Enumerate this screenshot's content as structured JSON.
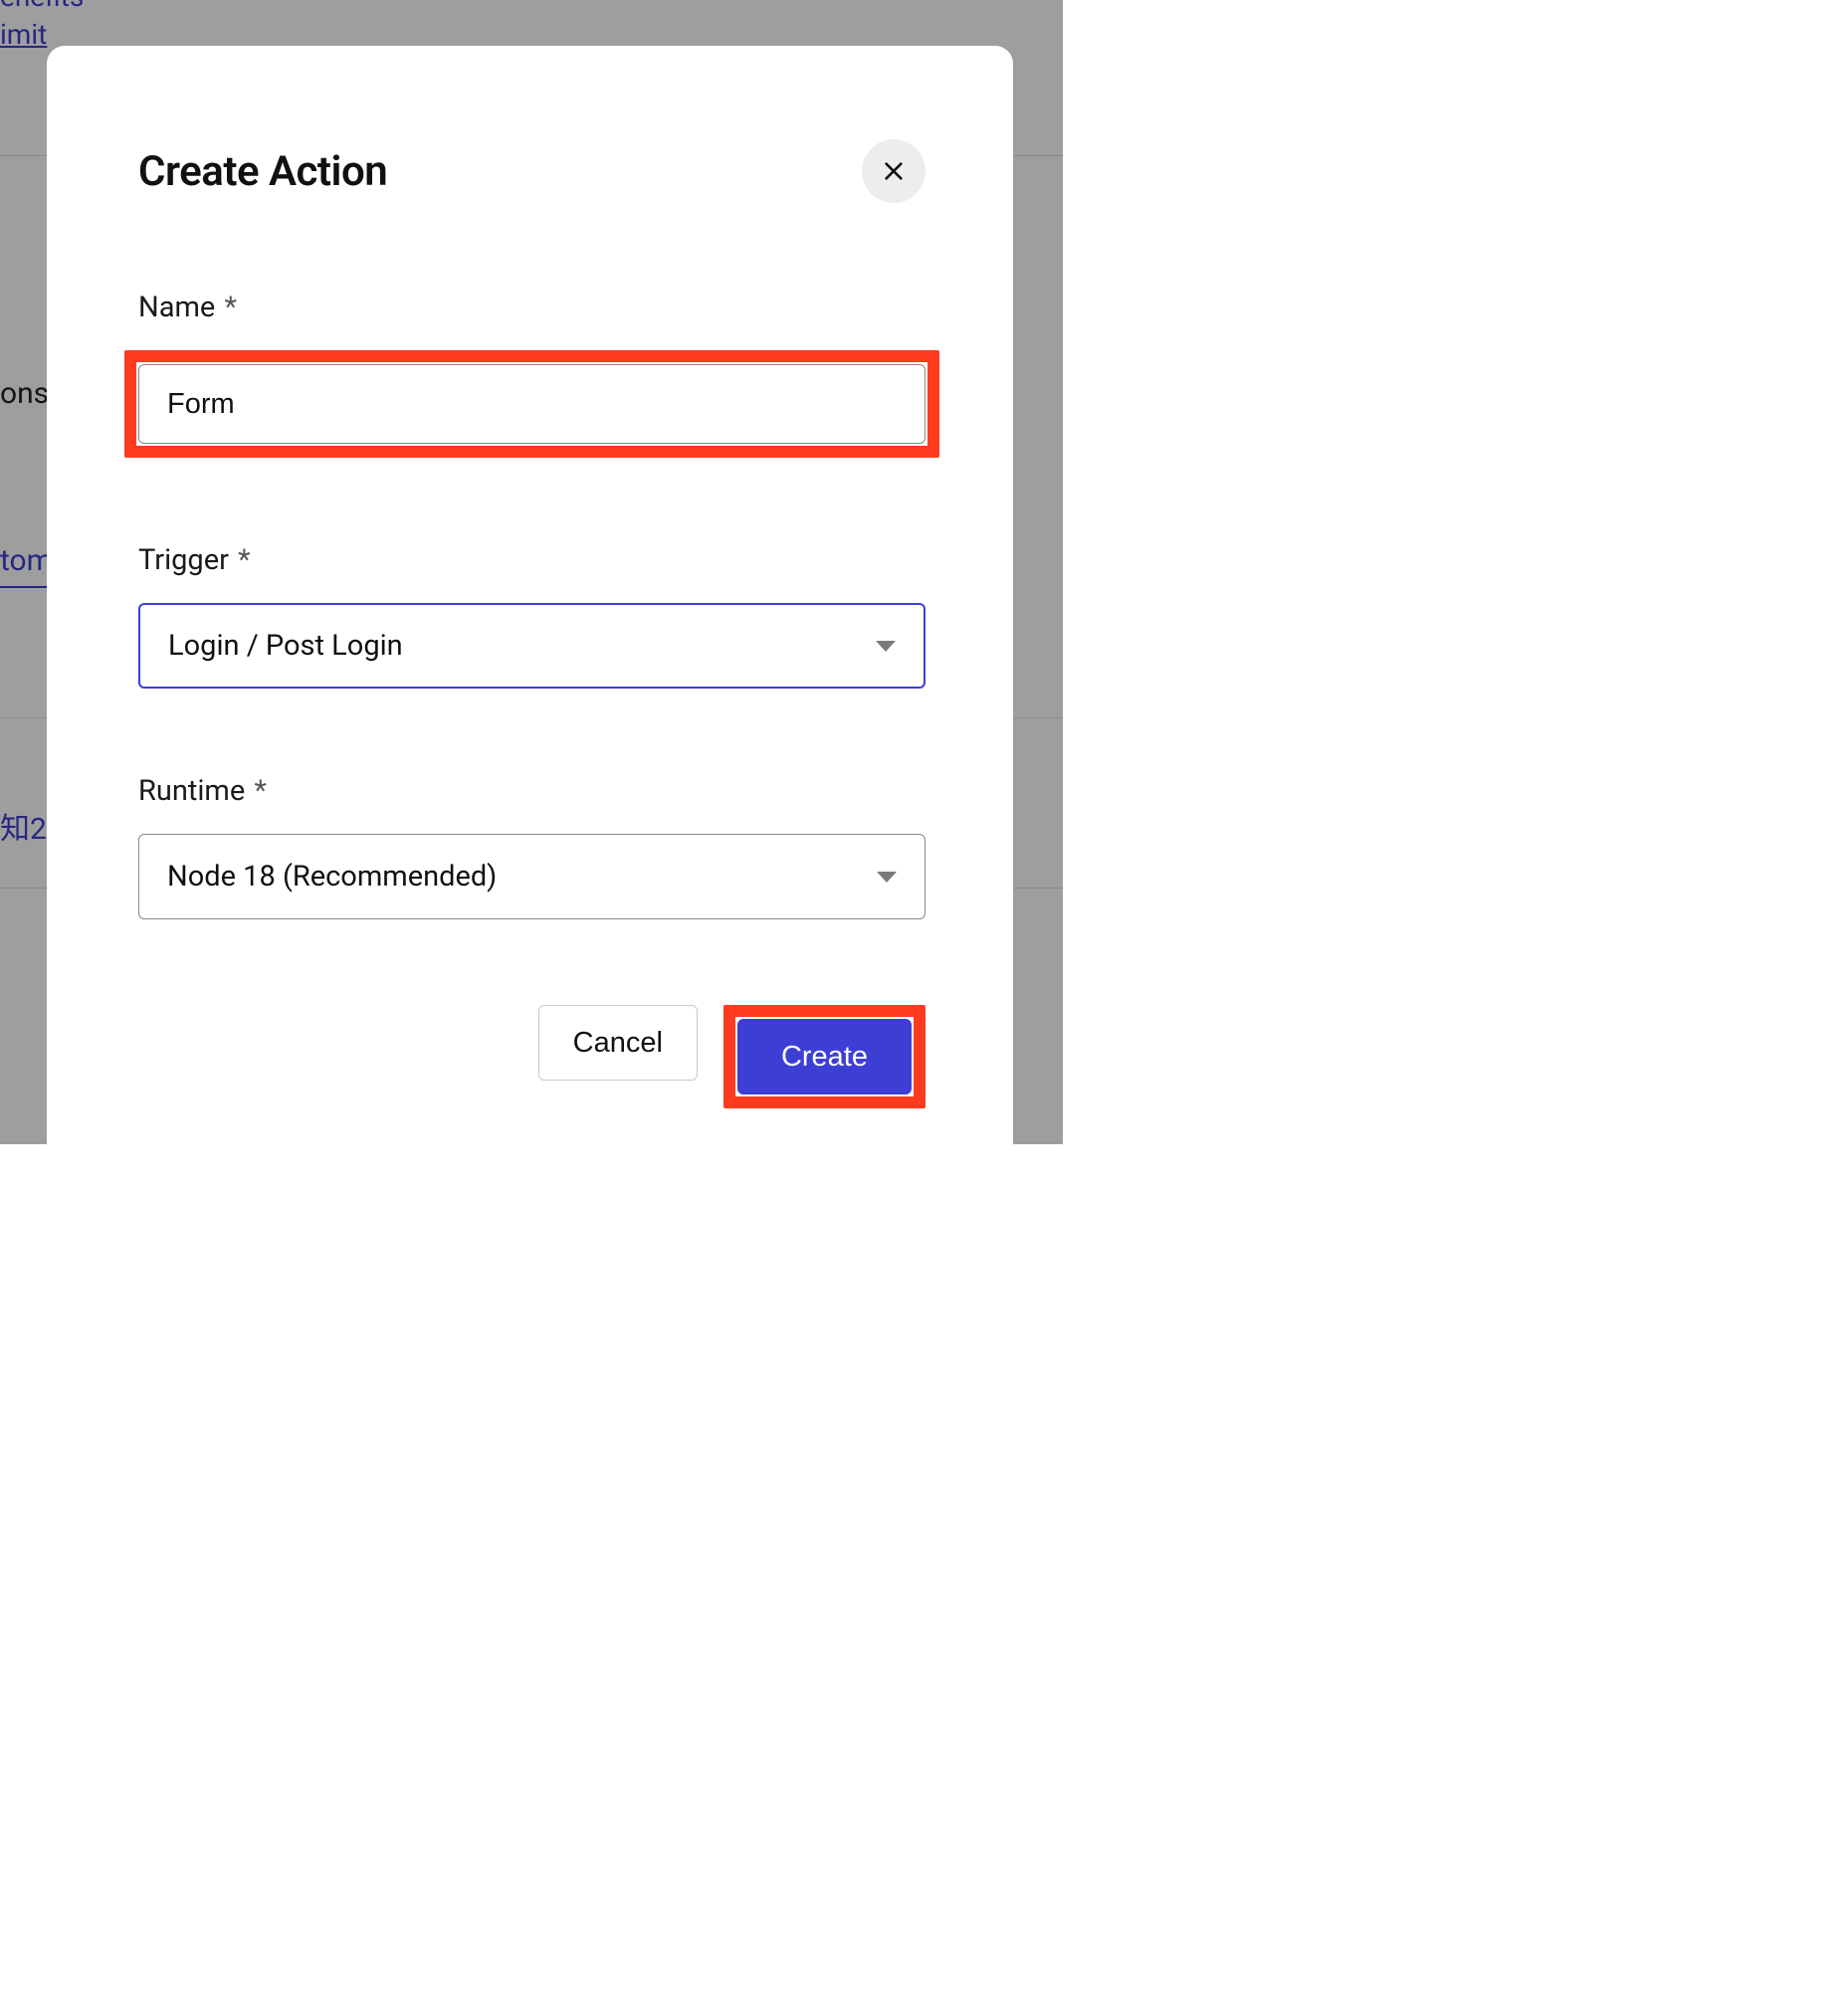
{
  "background": {
    "link0": "enefits",
    "link1": "imit",
    "row": "ons",
    "tab": "tom",
    "item": "知2"
  },
  "modal": {
    "title": "Create Action",
    "fields": {
      "name": {
        "label": "Name",
        "required": "*",
        "value": "Form"
      },
      "trigger": {
        "label": "Trigger",
        "required": "*",
        "value": "Login / Post Login"
      },
      "runtime": {
        "label": "Runtime",
        "required": "*",
        "value": "Node 18 (Recommended)"
      }
    },
    "buttons": {
      "cancel": "Cancel",
      "create": "Create"
    }
  }
}
